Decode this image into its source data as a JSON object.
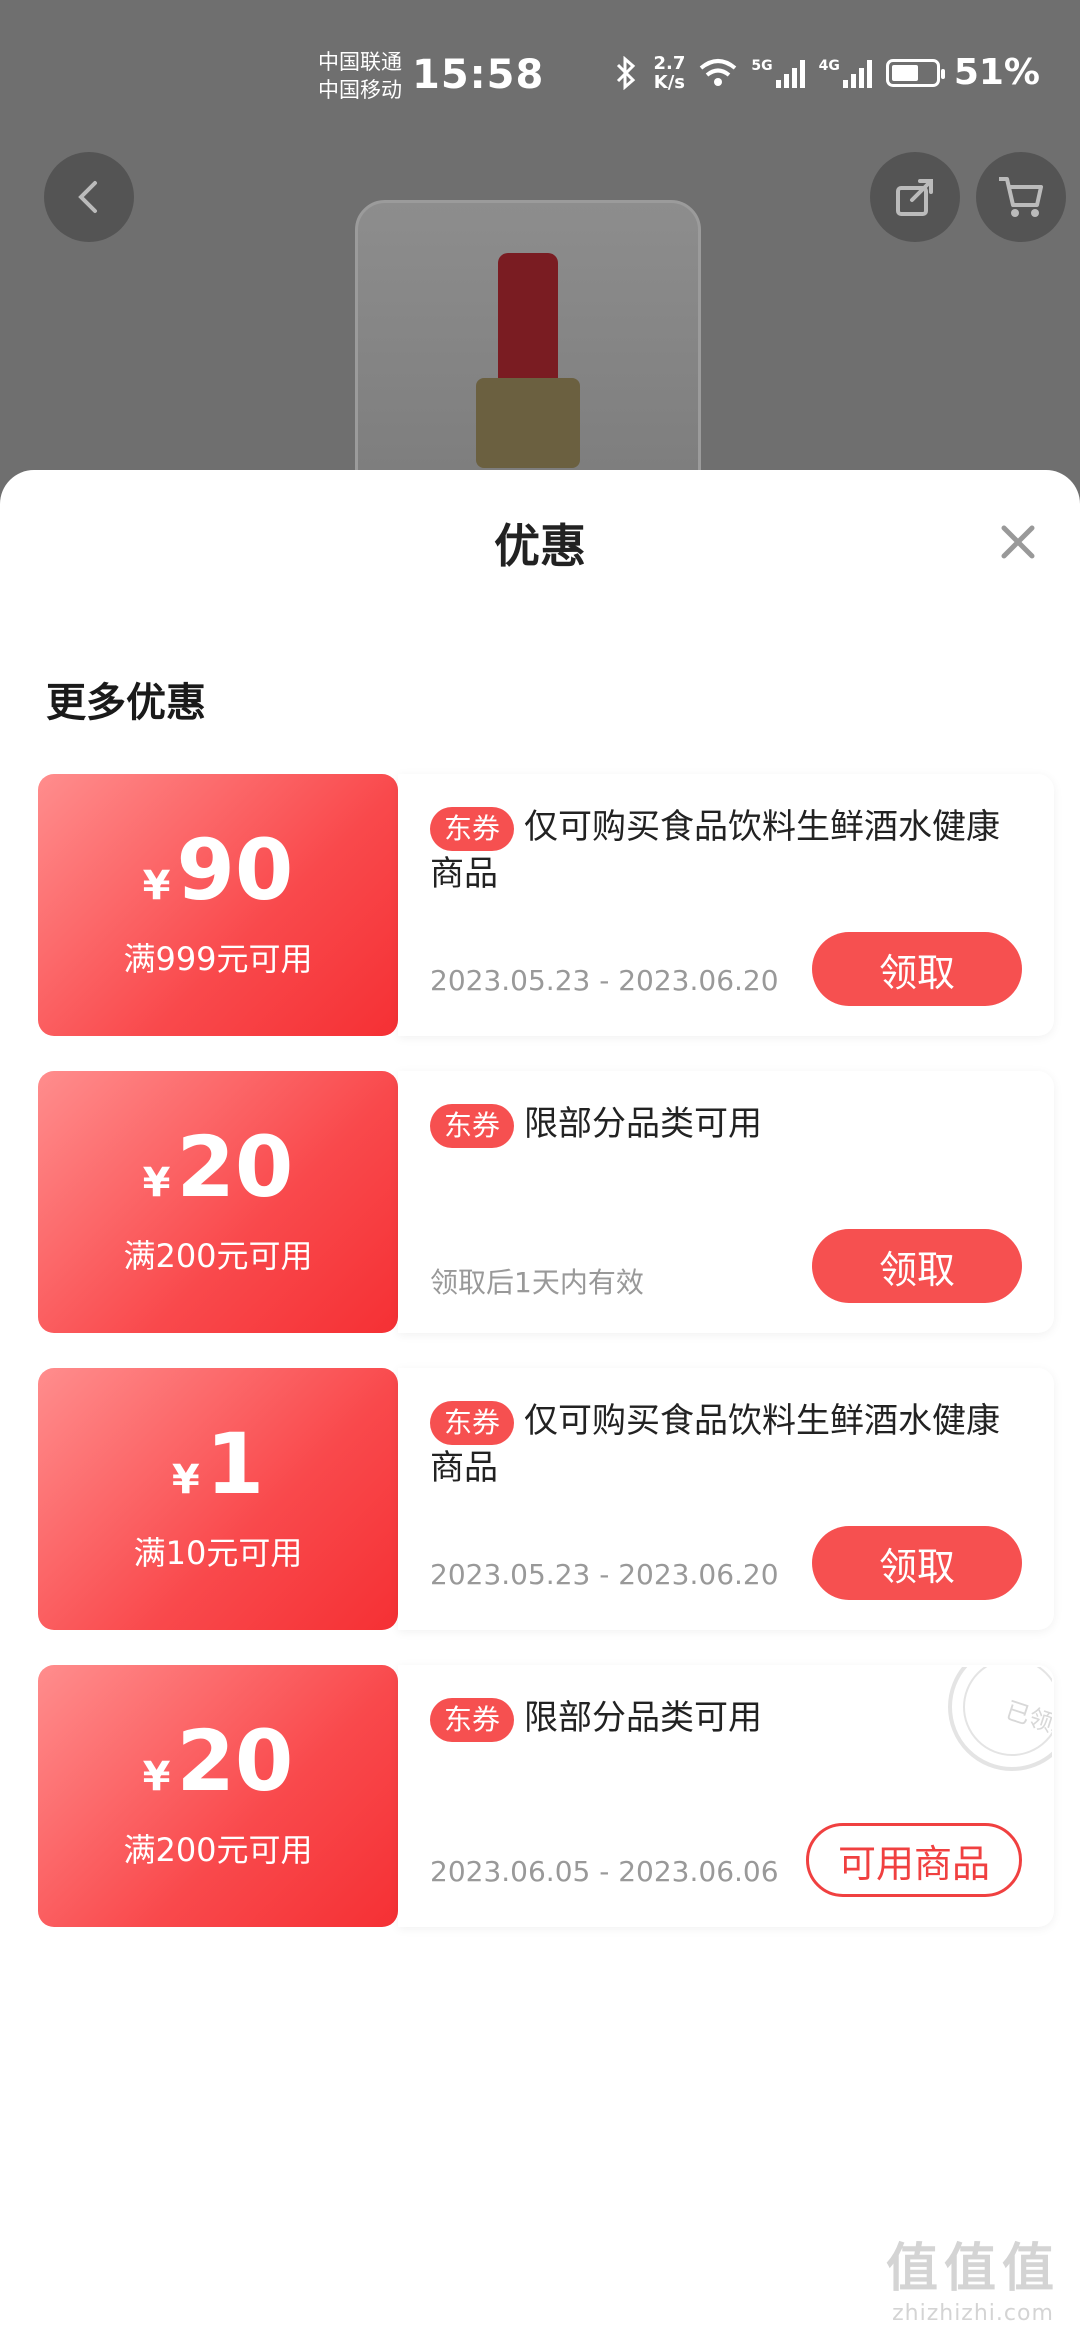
{
  "status_bar": {
    "carrier_1": "中国联通",
    "carrier_2": "中国移动",
    "time": "15:58",
    "net_speed_value": "2.7",
    "net_speed_unit": "K/s",
    "sig1_label": "5G",
    "sig2_label": "4G",
    "battery": "51%"
  },
  "sheet": {
    "title": "优惠",
    "section_title": "更多优惠"
  },
  "coupons": [
    {
      "yen": "¥",
      "amount": "90",
      "condition": "满999元可用",
      "tag": "东券",
      "description": "仅可购买食品饮料生鲜酒水健康商品",
      "validity": "2023.05.23 - 2023.06.20",
      "action": "领取"
    },
    {
      "yen": "¥",
      "amount": "20",
      "condition": "满200元可用",
      "tag": "东券",
      "description": "限部分品类可用",
      "validity": "领取后1天内有效",
      "action": "领取"
    },
    {
      "yen": "¥",
      "amount": "1",
      "condition": "满10元可用",
      "tag": "东券",
      "description": "仅可购买食品饮料生鲜酒水健康商品",
      "validity": "2023.05.23 - 2023.06.20",
      "action": "领取"
    },
    {
      "yen": "¥",
      "amount": "20",
      "condition": "满200元可用",
      "tag": "东券",
      "description": "限部分品类可用",
      "validity": "2023.06.05 - 2023.06.06",
      "action": "可用商品",
      "stamp": "已领取"
    }
  ],
  "watermark": {
    "logo": "值值值",
    "url": "zhizhizhi.com"
  },
  "colors": {
    "accent": "#f65050",
    "coupon_gradient_start": "#ff8d8d",
    "coupon_gradient_end": "#f53034"
  }
}
